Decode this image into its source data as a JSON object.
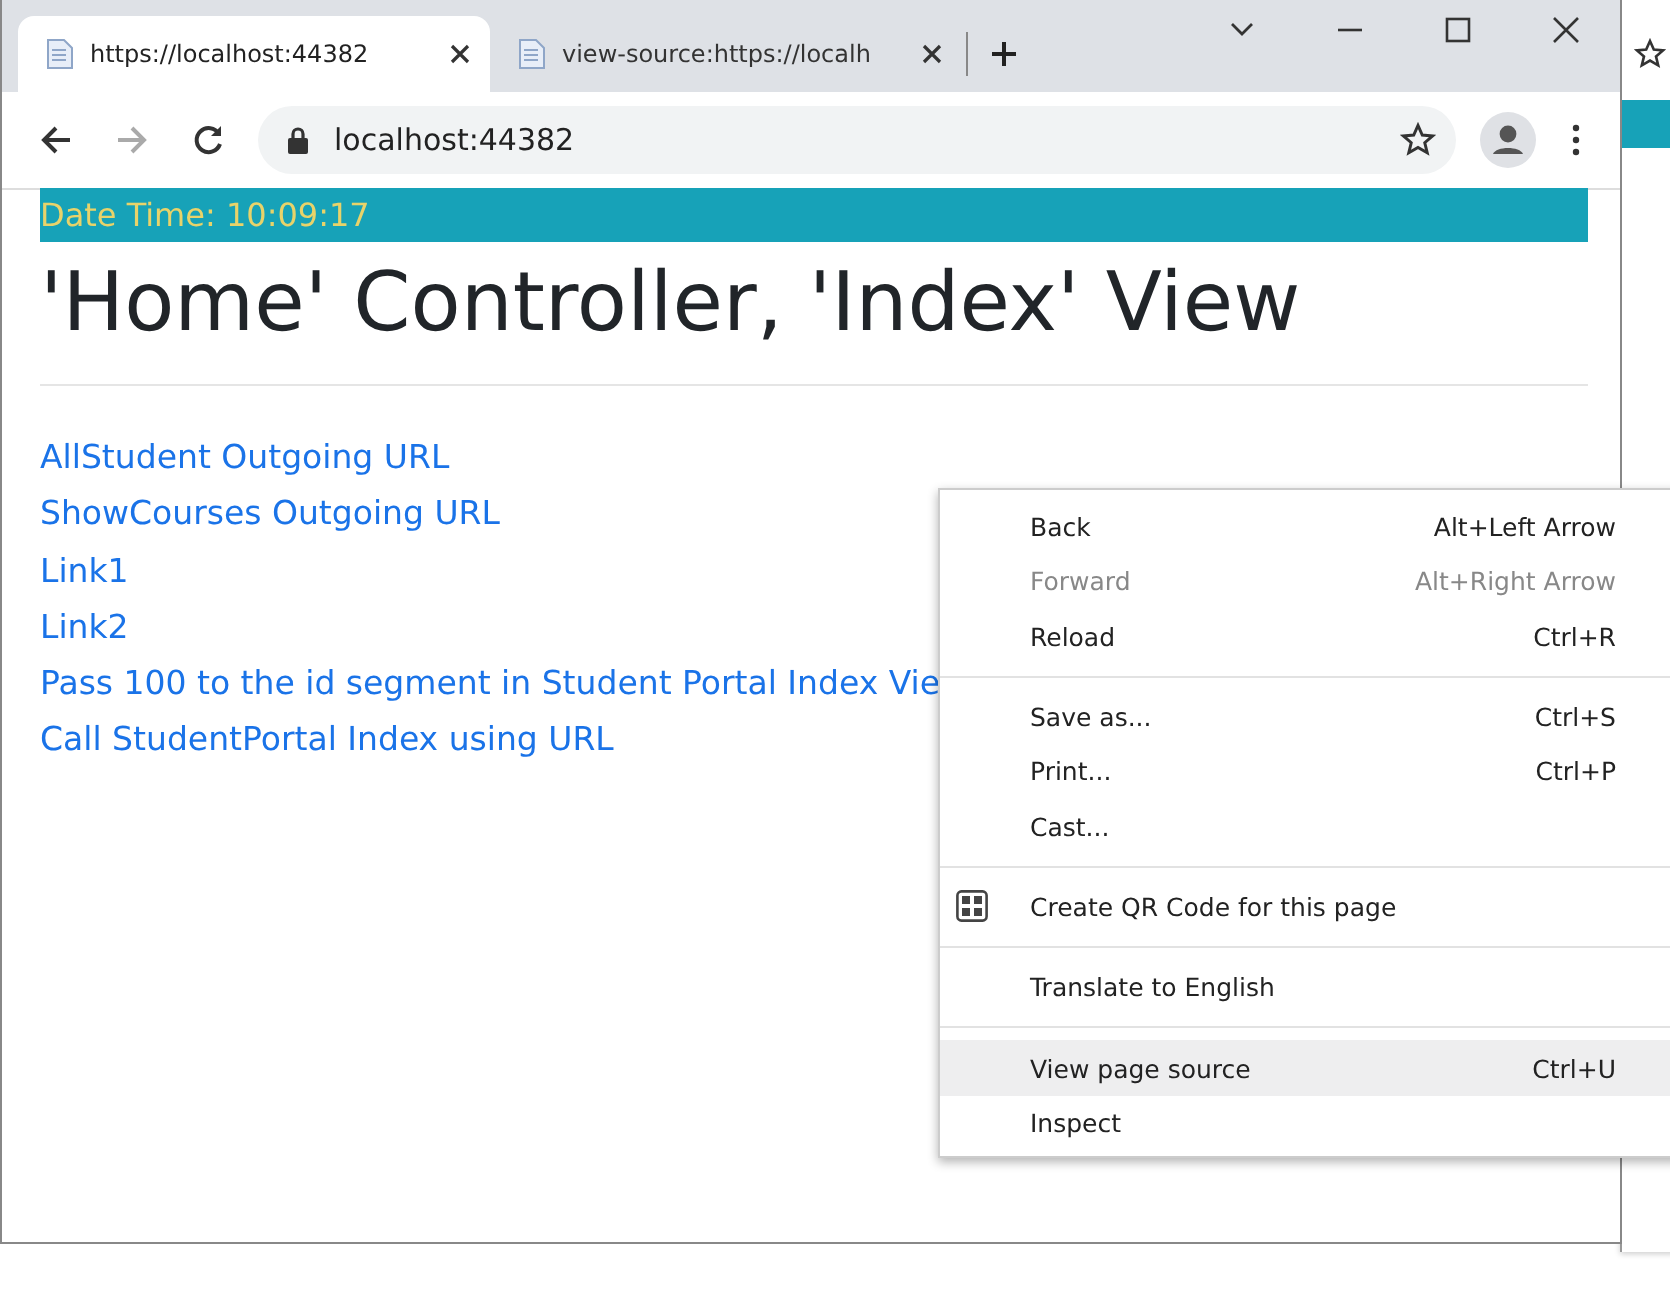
{
  "browser": {
    "tabs": [
      {
        "title": "https://localhost:44382",
        "selected": true
      },
      {
        "title": "view-source:https://localh",
        "selected": false
      }
    ],
    "address": "localhost:44382"
  },
  "page": {
    "datetime": "Date Time: 10:09:17",
    "heading": "'Home' Controller, 'Index' View",
    "links": [
      "AllStudent Outgoing URL",
      "ShowCourses Outgoing URL",
      "Link1",
      "Link2",
      "Pass 100 to the id segment in Student Portal Index Vie",
      "Call StudentPortal Index using URL"
    ]
  },
  "context_menu": {
    "groups": [
      {
        "items": [
          {
            "label": "Back",
            "shortcut": "Alt+Left Arrow",
            "disabled": false,
            "selected": false,
            "kind": "plain"
          },
          {
            "label": "Forward",
            "shortcut": "Alt+Right Arrow",
            "disabled": true,
            "selected": false,
            "kind": "plain"
          },
          {
            "label": "Reload",
            "shortcut": "Ctrl+R",
            "disabled": false,
            "selected": false,
            "kind": "plain"
          }
        ]
      },
      {
        "items": [
          {
            "label": "Save as...",
            "shortcut": "Ctrl+S",
            "disabled": false,
            "selected": false,
            "kind": "plain"
          },
          {
            "label": "Print...",
            "shortcut": "Ctrl+P",
            "disabled": false,
            "selected": false,
            "kind": "plain"
          },
          {
            "label": "Cast...",
            "disabled": false,
            "selected": false,
            "kind": "plain"
          }
        ]
      },
      {
        "items": [
          {
            "label": "Create QR Code for this page",
            "disabled": false,
            "selected": false,
            "kind": "qr"
          }
        ]
      },
      {
        "items": [
          {
            "label": "Translate to English",
            "disabled": false,
            "selected": false,
            "kind": "plain"
          }
        ]
      },
      {
        "items": [
          {
            "label": "View page source",
            "shortcut": "Ctrl+U",
            "disabled": false,
            "selected": true,
            "kind": "plain"
          },
          {
            "label": "Inspect",
            "disabled": false,
            "selected": false,
            "kind": "plain"
          }
        ]
      }
    ]
  }
}
